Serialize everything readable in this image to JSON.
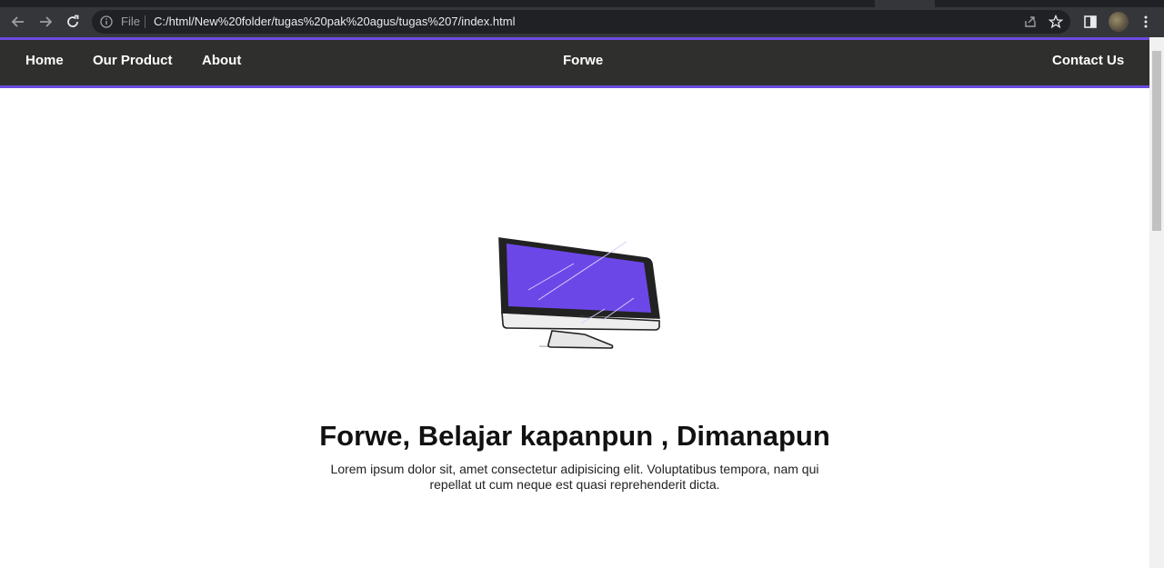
{
  "browser": {
    "omnibox_label": "File",
    "url": "C:/html/New%20folder/tugas%20pak%20agus/tugas%207/index.html"
  },
  "nav": {
    "items": [
      {
        "label": "Home"
      },
      {
        "label": "Our Product"
      },
      {
        "label": "About"
      }
    ],
    "brand": "Forwe",
    "contact": "Contact Us"
  },
  "hero": {
    "title": "Forwe, Belajar kapanpun , Dimanapun",
    "description": "Lorem ipsum dolor sit, amet consectetur adipisicing elit. Voluptatibus tempora, nam qui repellat ut cum neque est quasi reprehenderit dicta."
  },
  "theme": {
    "accent": "#6a4be0",
    "nav_bg": "#2f302e",
    "screen": "#6c47e8"
  }
}
